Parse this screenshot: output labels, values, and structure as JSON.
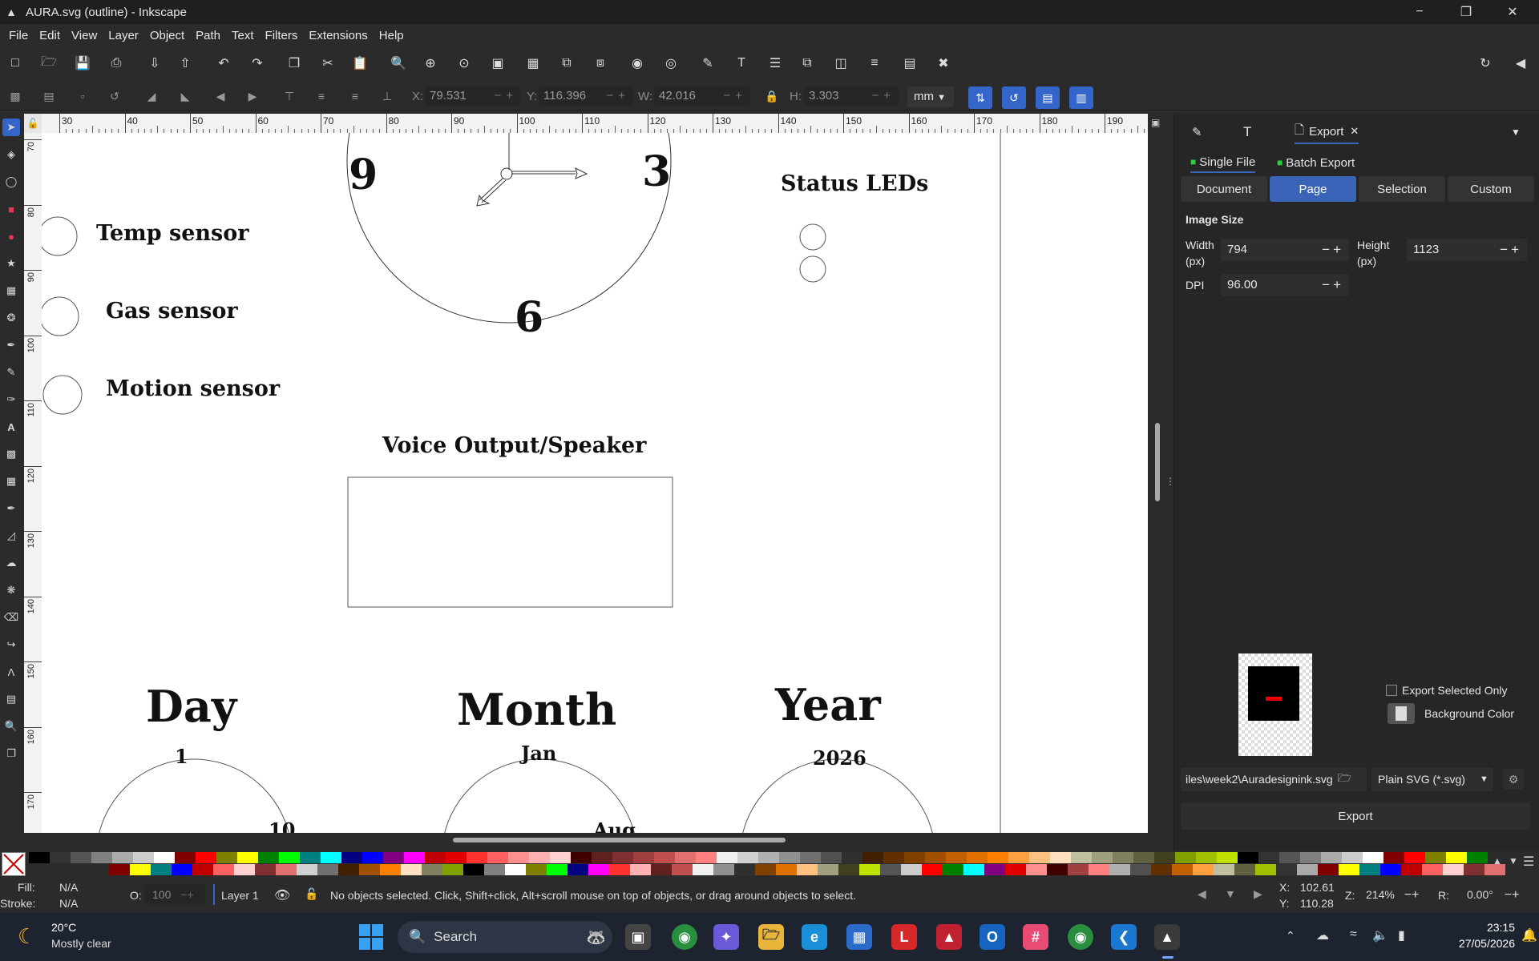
{
  "window": {
    "title": "AURA.svg (outline) - Inkscape",
    "minimize": "−",
    "restore": "❐",
    "close": "✕"
  },
  "menu": [
    "File",
    "Edit",
    "View",
    "Layer",
    "Object",
    "Path",
    "Text",
    "Filters",
    "Extensions",
    "Help"
  ],
  "tool_controls": {
    "x_label": "X:",
    "x_value": "79.531",
    "y_label": "Y:",
    "y_value": "116.396",
    "w_label": "W:",
    "w_value": "42.016",
    "h_label": "H:",
    "h_value": "3.303",
    "unit": "mm"
  },
  "rulers": {
    "horizontal": [
      "30",
      "40",
      "50",
      "60",
      "70",
      "80",
      "90",
      "100",
      "110",
      "120",
      "130",
      "140",
      "150",
      "160",
      "170",
      "180",
      "190"
    ],
    "vertical": [
      "70",
      "80",
      "90",
      "100",
      "110",
      "120",
      "130",
      "140",
      "150",
      "160",
      "170"
    ]
  },
  "drawing": {
    "clock_numbers": {
      "nine": "9",
      "three": "3",
      "six": "6"
    },
    "status_leds": "Status LEDs",
    "temp_sensor": "Temp sensor",
    "gas_sensor": "Gas sensor",
    "motion_sensor": "Motion sensor",
    "voice_output": "Voice Output/Speaker",
    "day_label": "Day",
    "month_label": "Month",
    "year_label": "Year",
    "day_value": "1",
    "month_value": "Jan",
    "year_value": "2026",
    "day_partial": "10",
    "month_partial": "Aug"
  },
  "export_panel": {
    "tab_export": "Export",
    "single_file": "Single File",
    "batch_export": "Batch Export",
    "areas": [
      "Document",
      "Page",
      "Selection",
      "Custom"
    ],
    "active_area": "Page",
    "image_size_heading": "Image Size",
    "width_label": "Width\n(px)",
    "width_value": "794",
    "height_label": "Height\n(px)",
    "height_value": "1123",
    "dpi_label": "DPI",
    "dpi_value": "96.00",
    "export_selected_only": "Export Selected Only",
    "background_color": "Background Color",
    "filename": "iles\\week2\\Auradesignink.svg",
    "format": "Plain SVG (*.svg)",
    "export_button": "Export"
  },
  "status": {
    "fill_label": "Fill:",
    "fill_value": "N/A",
    "stroke_label": "Stroke:",
    "stroke_value": "N/A",
    "opacity_label": "O:",
    "opacity_value": "100",
    "layer": "Layer 1",
    "message": "No objects selected. Click, Shift+click, Alt+scroll mouse on top of objects, or drag around objects to select.",
    "cursor_x_label": "X:",
    "cursor_x": "102.61",
    "cursor_y_label": "Y:",
    "cursor_y": "110.28",
    "zoom_label": "Z:",
    "zoom": "214%",
    "rotation_label": "R:",
    "rotation": "0.00°"
  },
  "taskbar": {
    "weather_temp": "20°C",
    "weather_desc": "Mostly clear",
    "search": "Search",
    "time": "23:15",
    "date": "27/05/2026"
  },
  "colors": {
    "accent": "#3a64b8",
    "panel_bg": "#262626",
    "app_bg": "#2b2b2b"
  },
  "palette": [
    "#000000",
    "#333333",
    "#555555",
    "#808080",
    "#aaaaaa",
    "#cccccc",
    "#ffffff",
    "#800000",
    "#ff0000",
    "#808000",
    "#ffff00",
    "#008000",
    "#00ff00",
    "#008080",
    "#00ffff",
    "#000080",
    "#0000ff",
    "#800080",
    "#ff00ff",
    "#c00000",
    "#e00000",
    "#ff3030",
    "#ff6060",
    "#ff9090",
    "#ffb0b0",
    "#ffd0d0",
    "#400000",
    "#602020",
    "#803030",
    "#a04040",
    "#c05050",
    "#e07070",
    "#ff8080",
    "#f0f0f0",
    "#d0d0d0",
    "#b0b0b0",
    "#909090",
    "#707070",
    "#505050",
    "#303030",
    "#402000",
    "#603000",
    "#804000",
    "#a05000",
    "#c06000",
    "#e07000",
    "#ff8000",
    "#ffa040",
    "#ffc080",
    "#ffe0c0",
    "#c0c0a0",
    "#a0a080",
    "#808060",
    "#606040",
    "#404020",
    "#80a000",
    "#a0c000",
    "#c0e000"
  ]
}
